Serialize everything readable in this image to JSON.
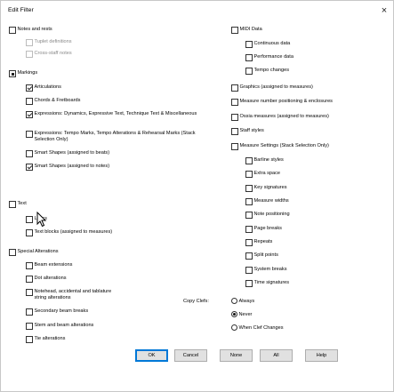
{
  "window": {
    "title": "Edit Filter",
    "close_glyph": "×"
  },
  "left": {
    "notes_and_rests": "Notes and rests",
    "tuplet_definitions": "Tuplet definitions",
    "cross_staff_notes": "Cross-staff notes",
    "markings": "Markings",
    "articulations": "Articulations",
    "chords_fretboards": "Chords & Fretboards",
    "expressions_dynamics": "Expressions: Dynamics, Expressive Text, Technique Text & Miscellaneous",
    "expressions_tempo": "Expressions: Tempo Marks, Tempo Alterations & Rehearsal Marks (Stack Selection Only)",
    "smart_shapes_beats": "Smart Shapes (assigned to beats)",
    "smart_shapes_notes": "Smart Shapes (assigned to notes)",
    "text": "Text",
    "lyrics": "Lyrics",
    "text_blocks": "Text blocks (assigned to measures)",
    "special_alterations": "Special Alterations",
    "beam_extensions": "Beam extensions",
    "dot_alterations": "Dot alterations",
    "notehead": "Notehead, accidental and tablature string alterations",
    "secondary_beam_breaks": "Secondary beam breaks",
    "stem_beam_alterations": "Stem and beam alterations",
    "tie_alterations": "Tie alterations"
  },
  "right": {
    "midi_data": "MIDI Data",
    "continuous_data": "Continuous data",
    "performance_data": "Performance data",
    "tempo_changes": "Tempo changes",
    "graphics": "Graphics (assigned to measures)",
    "measure_number": "Measure number positioning & enclosures",
    "ossia": "Ossia measures (assigned to measures)",
    "staff_styles": "Staff styles",
    "measure_settings": "Measure Settings (Stack Selection Only)",
    "barline_styles": "Barline styles",
    "extra_space": "Extra space",
    "key_signatures": "Key signatures",
    "measure_widths": "Measure widths",
    "note_positioning": "Note positioning",
    "page_breaks": "Page breaks",
    "repeats": "Repeats",
    "split_points": "Split points",
    "system_breaks": "System breaks",
    "time_signatures": "Time signatures"
  },
  "copy_clefs": {
    "label": "Copy Clefs:",
    "always": "Always",
    "never": "Never",
    "when_changes": "When Clef Changes",
    "selected": "never"
  },
  "buttons": {
    "ok": "OK",
    "cancel": "Cancel",
    "none": "None",
    "all": "All",
    "help": "Help"
  }
}
